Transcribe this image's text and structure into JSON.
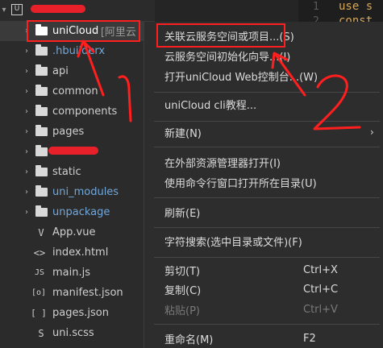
{
  "explorer": {
    "root_item": "",
    "items": [
      {
        "label": "uniCloud",
        "suffix": " - [阿里云",
        "icon": "folder-icon",
        "expandable": true
      },
      {
        "label": ".hbuilderx",
        "icon": "folder-icon",
        "expandable": true
      },
      {
        "label": "api",
        "icon": "folder-icon",
        "expandable": true
      },
      {
        "label": "common",
        "icon": "folder-icon",
        "expandable": true
      },
      {
        "label": "components",
        "icon": "folder-icon",
        "expandable": true
      },
      {
        "label": "pages",
        "icon": "folder-icon",
        "expandable": true
      },
      {
        "label": "",
        "icon": "folder-icon",
        "expandable": true,
        "redacted": true
      },
      {
        "label": "static",
        "icon": "folder-icon",
        "expandable": true
      },
      {
        "label": "uni_modules",
        "icon": "folder-icon",
        "expandable": true,
        "color": "#6fa8dc"
      },
      {
        "label": "unpackage",
        "icon": "folder-icon",
        "expandable": true,
        "color": "#6fa8dc"
      },
      {
        "label": "App.vue",
        "icon": "vue-file-icon",
        "glyph": "V"
      },
      {
        "label": "index.html",
        "icon": "html-file-icon",
        "glyph": "<>"
      },
      {
        "label": "main.js",
        "icon": "js-file-icon",
        "glyph": "JS"
      },
      {
        "label": "manifest.json",
        "icon": "manifest-file-icon",
        "glyph": "[o]"
      },
      {
        "label": "pages.json",
        "icon": "json-file-icon",
        "glyph": "[ ]"
      },
      {
        "label": "uni.scss",
        "icon": "scss-file-icon",
        "glyph": "S"
      }
    ]
  },
  "editor": {
    "lines": [
      {
        "number": "1",
        "code": "use s"
      },
      {
        "number": "2",
        "code": "const c"
      }
    ]
  },
  "context_menu": {
    "items": [
      {
        "label": "关联云服务空间或项目...(S)",
        "shortcut": ""
      },
      {
        "label": "云服务空间初始化向导...(I)",
        "shortcut": ""
      },
      {
        "label": "打开uniCloud Web控制台...(W)",
        "shortcut": ""
      },
      {
        "label": "uniCloud cli教程...",
        "shortcut": ""
      },
      {
        "label": "新建(N)",
        "shortcut": "",
        "submenu": true
      },
      {
        "label": "在外部资源管理器打开(I)",
        "shortcut": ""
      },
      {
        "label": "使用命令行窗口打开所在目录(U)",
        "shortcut": ""
      },
      {
        "label": "刷新(E)",
        "shortcut": ""
      },
      {
        "label": "字符搜索(选中目录或文件)(F)",
        "shortcut": ""
      },
      {
        "label": "剪切(T)",
        "shortcut": "Ctrl+X"
      },
      {
        "label": "复制(C)",
        "shortcut": "Ctrl+C"
      },
      {
        "label": "粘贴(P)",
        "shortcut": "Ctrl+V",
        "disabled": true
      },
      {
        "label": "重命名(M)",
        "shortcut": "F2"
      }
    ]
  },
  "annotations": {
    "step1": "1",
    "step2": "2",
    "color": "#ff1f1f"
  }
}
